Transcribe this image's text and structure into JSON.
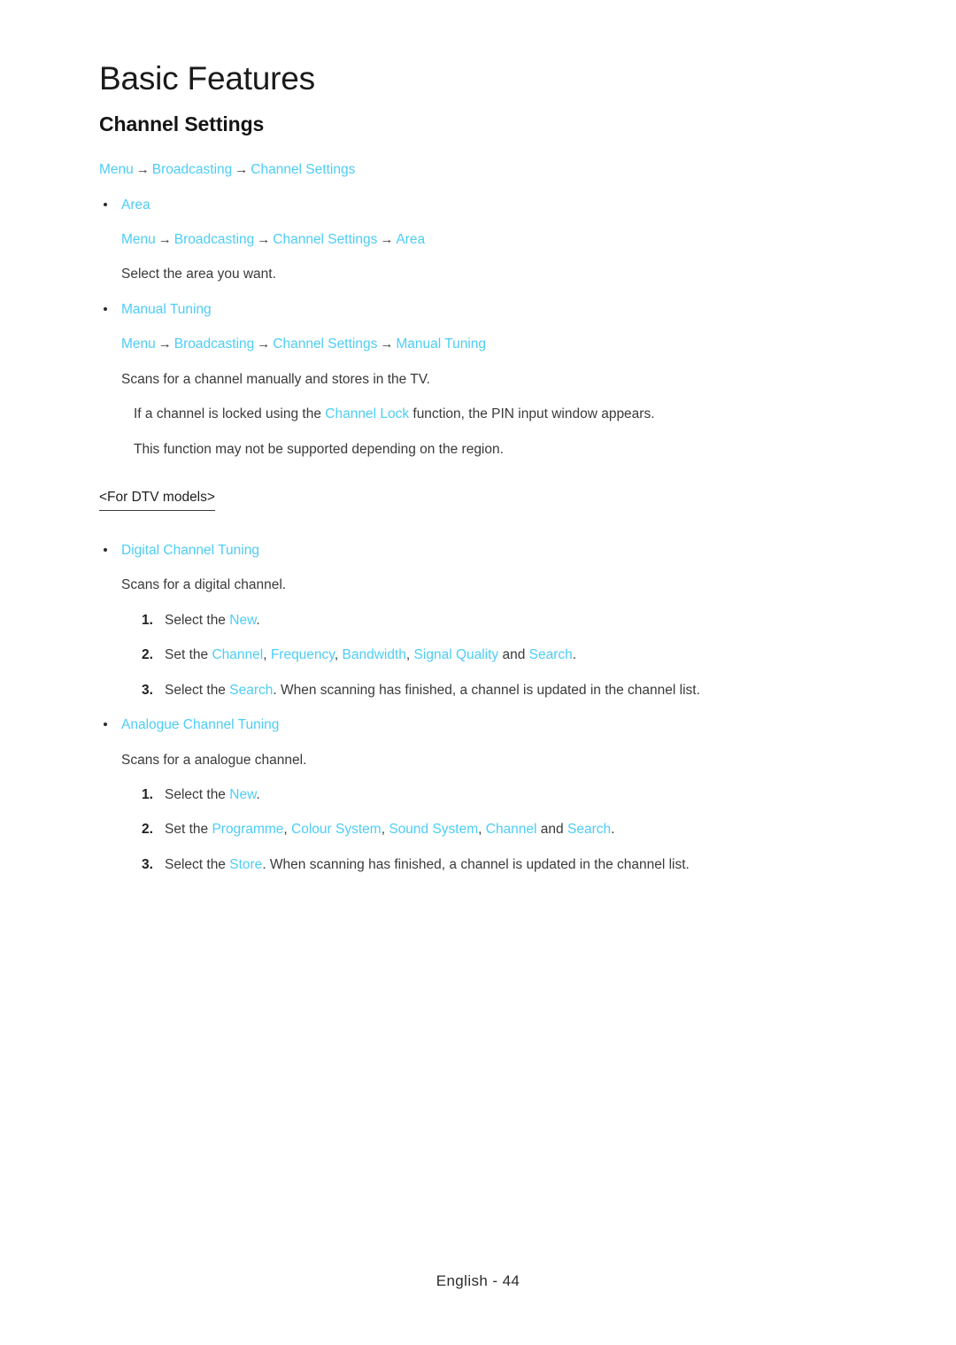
{
  "page": {
    "chapter_title": "Basic Features",
    "section_title": "Channel Settings",
    "footer": "English - 44",
    "accent_color": "#4dcdf5",
    "text_color": "#3a3a3a",
    "arrow_glyph": "→",
    "bullet_glyph": "•"
  },
  "breadcrumb_main": {
    "parts": [
      "Menu",
      "Broadcasting",
      "Channel Settings"
    ]
  },
  "sections": [
    {
      "bullet_label": "Area",
      "breadcrumb": [
        "Menu",
        "Broadcasting",
        "Channel Settings",
        "Area"
      ],
      "body": "Select the area you want."
    },
    {
      "bullet_label": "Manual Tuning",
      "breadcrumb": [
        "Menu",
        "Broadcasting",
        "Channel Settings",
        "Manual Tuning"
      ],
      "body": "Scans for a channel manually and stores in the TV.",
      "notes": [
        {
          "pre": "If a channel is locked using the ",
          "link": "Channel Lock",
          "post": " function, the PIN input window appears."
        },
        {
          "pre": "This function may not be supported depending on the region.",
          "link": "",
          "post": ""
        }
      ]
    }
  ],
  "model_note": "<For DTV models>",
  "tuning_blocks": [
    {
      "bullet_label": "Digital Channel Tuning",
      "body": "Scans for a digital channel.",
      "steps": [
        {
          "num": "1.",
          "segments": [
            {
              "text": "Select the ",
              "accent": false
            },
            {
              "text": "New",
              "accent": true
            },
            {
              "text": ".",
              "accent": false
            }
          ]
        },
        {
          "num": "2.",
          "segments": [
            {
              "text": "Set the ",
              "accent": false
            },
            {
              "text": "Channel",
              "accent": true
            },
            {
              "text": ", ",
              "accent": false
            },
            {
              "text": "Frequency",
              "accent": true
            },
            {
              "text": ", ",
              "accent": false
            },
            {
              "text": "Bandwidth",
              "accent": true
            },
            {
              "text": ", ",
              "accent": false
            },
            {
              "text": "Signal Quality",
              "accent": true
            },
            {
              "text": " and ",
              "accent": false
            },
            {
              "text": "Search",
              "accent": true
            },
            {
              "text": ".",
              "accent": false
            }
          ]
        },
        {
          "num": "3.",
          "segments": [
            {
              "text": "Select the ",
              "accent": false
            },
            {
              "text": "Search",
              "accent": true
            },
            {
              "text": ". When scanning has finished, a channel is updated in the channel list.",
              "accent": false
            }
          ]
        }
      ]
    },
    {
      "bullet_label": "Analogue Channel Tuning",
      "body": "Scans for a analogue channel.",
      "steps": [
        {
          "num": "1.",
          "segments": [
            {
              "text": "Select the ",
              "accent": false
            },
            {
              "text": "New",
              "accent": true
            },
            {
              "text": ".",
              "accent": false
            }
          ]
        },
        {
          "num": "2.",
          "segments": [
            {
              "text": "Set the ",
              "accent": false
            },
            {
              "text": "Programme",
              "accent": true
            },
            {
              "text": ", ",
              "accent": false
            },
            {
              "text": "Colour System",
              "accent": true
            },
            {
              "text": ", ",
              "accent": false
            },
            {
              "text": "Sound System",
              "accent": true
            },
            {
              "text": ", ",
              "accent": false
            },
            {
              "text": "Channel",
              "accent": true
            },
            {
              "text": " and ",
              "accent": false
            },
            {
              "text": "Search",
              "accent": true
            },
            {
              "text": ".",
              "accent": false
            }
          ]
        },
        {
          "num": "3.",
          "segments": [
            {
              "text": "Select the ",
              "accent": false
            },
            {
              "text": "Store",
              "accent": true
            },
            {
              "text": ". When scanning has finished, a channel is updated in the channel list.",
              "accent": false
            }
          ]
        }
      ]
    }
  ]
}
